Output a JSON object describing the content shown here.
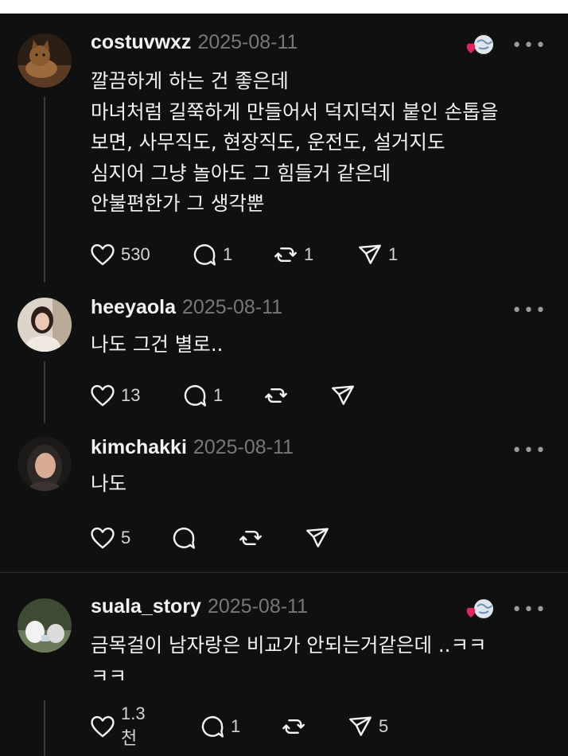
{
  "comments": [
    {
      "username": "costuvwxz",
      "date": "2025-08-11",
      "text": "깔끔하게 하는 건 좋은데\n마녀처럼 길쭉하게 만들어서 덕지덕지 붙인 손톱을\n보면, 사무직도, 현장직도, 운전도, 설거지도\n심지어 그냥 놀아도 그 힘들거 같은데\n안불편한가 그 생각뿐",
      "likes": "530",
      "replies": "1",
      "reposts": "1",
      "shares": "1",
      "liked_by_author": true,
      "avatar_colors": [
        "#5a3a22",
        "#9c6a3c"
      ]
    },
    {
      "username": "heeyaola",
      "date": "2025-08-11",
      "text": "나도 그건 별로..",
      "likes": "13",
      "replies": "1",
      "reposts": "",
      "shares": "",
      "liked_by_author": false,
      "avatar_colors": [
        "#d8cfc4",
        "#a89a8a"
      ]
    },
    {
      "username": "kimchakki",
      "date": "2025-08-11",
      "text": "나도",
      "likes": "5",
      "replies": "",
      "reposts": "",
      "shares": "",
      "liked_by_author": false,
      "avatar_colors": [
        "#2a2624",
        "#c9a48a"
      ]
    },
    {
      "username": "suala_story",
      "date": "2025-08-11",
      "text": "금목걸이 남자랑은 비교가 안되는거같은데 ..ㅋㅋ\nㅋㅋ",
      "likes": "1.3천",
      "replies": "1",
      "reposts": "",
      "shares": "5",
      "liked_by_author": true,
      "avatar_colors": [
        "#4a5a3a",
        "#e6e6e6"
      ]
    }
  ],
  "more_icon": "•••",
  "colors": {
    "background": "#101010",
    "text": "#f3f3f3",
    "muted": "#777777",
    "heart_badge": "#e0245e"
  }
}
